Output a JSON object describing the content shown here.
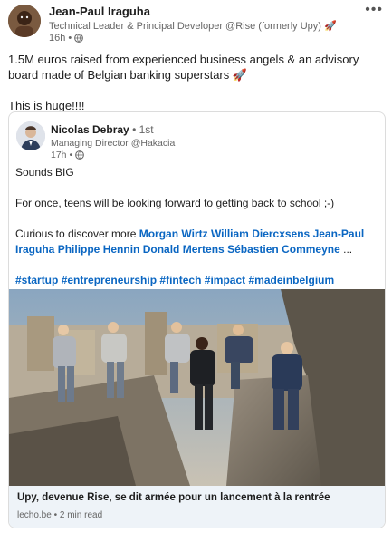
{
  "author": {
    "name": "Jean-Paul Iraguha",
    "headline": "Technical Leader & Principal Developer @Rise (formerly Upy) 🚀",
    "time": "16h",
    "separator": "•"
  },
  "post": {
    "line1": "1.5M euros raised from experienced business angels & an advisory board made of Belgian banking superstars 🚀",
    "line2": "This is huge!!!!"
  },
  "shared": {
    "name": "Nicolas Debray",
    "degree": "• 1st",
    "headline": "Managing Director @Hakacia",
    "time": "17h",
    "separator": "•",
    "p1": "Sounds BIG",
    "p2": "For once, teens will be looking forward to getting back to school ;-)",
    "p3_prefix": "Curious to discover more ",
    "mentions": [
      "Morgan Wirtz",
      "William Diercxsens",
      "Jean-Paul Iraguha",
      "Philippe Hennin",
      "Donald Mertens",
      "Sébastien Commeyne"
    ],
    "ellipsis": " ...",
    "hashtags": [
      "#startup",
      "#entrepreneurship",
      "#fintech",
      "#impact",
      "#madeinbelgium"
    ]
  },
  "article": {
    "title": "Upy, devenue Rise, se dit armée pour un lancement à la rentrée",
    "source": "lecho.be",
    "read_time": "2 min read",
    "separator": "•"
  },
  "icons": {
    "more": "more-options-icon",
    "visibility": "globe-icon"
  }
}
